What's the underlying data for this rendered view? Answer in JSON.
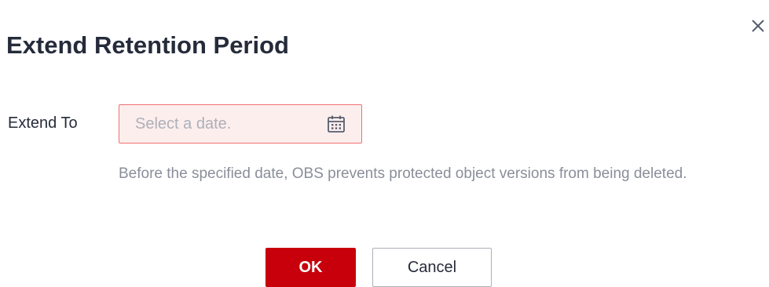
{
  "dialog": {
    "title": "Extend Retention Period",
    "close_icon": "close-icon"
  },
  "form": {
    "extend_to": {
      "label": "Extend To",
      "value": "",
      "placeholder": "Select a date.",
      "icon": "calendar-icon",
      "state": "error"
    },
    "hint": "Before the specified date, OBS prevents protected object versions from being deleted."
  },
  "footer": {
    "ok_label": "OK",
    "cancel_label": "Cancel"
  },
  "colors": {
    "primary": "#c7000b",
    "error_border": "#f0706e",
    "error_background": "#fdeeee",
    "hint_text": "#8a8e99"
  }
}
